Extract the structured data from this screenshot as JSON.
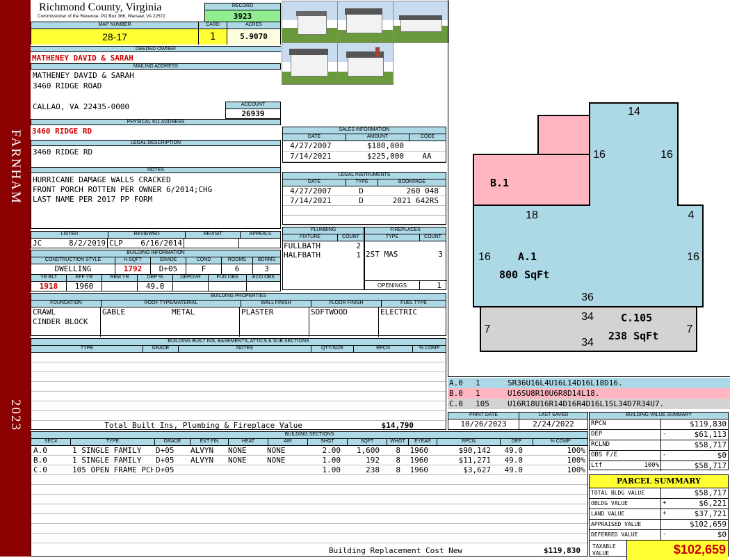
{
  "side": {
    "left_text": "FARNHAM",
    "year": "2023"
  },
  "header": {
    "county": "Richmond County, Virginia",
    "commissioner": "Commissioner of the Revenue, PO Box 366, Warsaw, VA 22572",
    "record_label": "RECORD",
    "record": "3923",
    "map_label": "MAP NUMBER",
    "map_number": "28-17",
    "card_label": "CARD",
    "card": "1",
    "acres_label": "ACRES",
    "acres": "5.9070"
  },
  "owner": {
    "deeded_label": "DEEDED OWNER",
    "deeded": "MATHENEY DAVID & SARAH",
    "mailing_label": "MAILING ADDRESS",
    "mail1": "MATHENEY DAVID & SARAH",
    "mail2": "3460 RIDGE ROAD",
    "mail3": "CALLAO, VA 22435-0000",
    "account_label": "ACCOUNT",
    "account": "26939",
    "phys_label": "PHYSICAL 911 ADDRESS",
    "phys": "3460 RIDGE RD",
    "legal_label": "LEGAL DESCRIPTION",
    "legal": "3460 RIDGE RD",
    "notes_label": "NOTES",
    "notes1": "HURRICANE DAMAGE WALLS CRACKED",
    "notes2": "FRONT PORCH ROTTEN PER OWNER 6/2014;CHG",
    "notes3": "LAST NAME PER 2017 PP FORM"
  },
  "review": {
    "listed_label": "LISTED",
    "reviewed_label": "REVIEWED",
    "revisit_label": "REVISIT",
    "appeals_label": "APPEALS",
    "listed_by": "JC",
    "listed_date": "8/2/2019",
    "reviewed_by": "CLP",
    "reviewed_date": "6/16/2014"
  },
  "building_info": {
    "title": "BUILDING INFORMATION",
    "h_style": "CONSTRUCTION STYLE",
    "h_sqft": "H SQFT",
    "h_grade": "GRADE",
    "h_cond": "COND",
    "h_rooms": "ROOMS",
    "h_bdrms": "BDRMS",
    "style": "DWELLING",
    "sqft": "1792",
    "grade": "D+05",
    "cond": "F",
    "rooms": "6",
    "bdrms": "3",
    "h_yrblt": "YR BLT",
    "h_effyr": "EFF YR",
    "h_remyr": "REM YR",
    "h_dep": "DEP %",
    "h_depovr": "DEPOVR",
    "h_funobs": "FUN OBS",
    "h_ecoobs": "ECO OBS",
    "yrblt": "1918",
    "effyr": "1960",
    "dep": "49.0"
  },
  "properties": {
    "title": "BUILDING PROPERTIES",
    "h_found": "FOUNDATION",
    "h_roof": "ROOF TYPE/MATERIAL",
    "h_wall": "WALL FINISH",
    "h_floor": "FLOOR FINISH",
    "h_fuel": "FUEL TYPE",
    "found1": "CRAWL",
    "found2": "CINDER BLOCK",
    "roof1": "GABLE",
    "roof2": "METAL",
    "wall": "PLASTER",
    "floor": "SOFTWOOD",
    "fuel": "ELECTRIC"
  },
  "builtins": {
    "title": "BUILDING BUILT INS, BASEMENTS, ATTICS & SUB SECTIONS",
    "h_type": "TYPE",
    "h_grade": "GRADE",
    "h_notes": "NOTES",
    "h_qty": "QTY/SIZE",
    "h_rpcn": "RPCN",
    "h_comp": "% COMP",
    "total_label": "Total Built Ins, Plumbing & Fireplace Value",
    "total": "$14,790"
  },
  "sales": {
    "title": "SALES INFORMATION",
    "h_date": "DATE",
    "h_amount": "AMOUNT",
    "h_code": "CODE",
    "rows": [
      {
        "date": "4/27/2007",
        "amount": "$180,000",
        "code": ""
      },
      {
        "date": "7/14/2021",
        "amount": "$225,000",
        "code": "AA"
      }
    ]
  },
  "legal_instruments": {
    "title": "LEGAL INSTRUMENTS",
    "h_date": "DATE",
    "h_type": "TYPE",
    "h_book": "BOOKPAGE",
    "rows": [
      {
        "date": "4/27/2007",
        "type": "D",
        "book": "260 048"
      },
      {
        "date": "7/14/2021",
        "type": "D",
        "book": "2021 642RS"
      }
    ]
  },
  "plumbing": {
    "title": "PLUMBING",
    "h_fixture": "FIXTURE",
    "h_count": "COUNT",
    "rows": [
      {
        "fixture": "FULLBATH",
        "count": "2"
      },
      {
        "fixture": "HALFBATH",
        "count": "1"
      }
    ]
  },
  "fireplaces": {
    "title": "FIREPLACES",
    "h_type": "TYPE",
    "h_count": "COUNT",
    "type": "2ST MAS",
    "count": "3",
    "openings_label": "OPENINGS",
    "openings": "1"
  },
  "sketch": {
    "a_label": "A.1",
    "a_area": "800 SqFt",
    "b_label": "B.1",
    "c_label": "C.105",
    "c_area": "238 SqFt",
    "dims": {
      "top": "14",
      "left16": "16",
      "right16": "16",
      "mid18": "18",
      "right4": "4",
      "aleft16": "16",
      "aright16": "16",
      "bottom36": "36",
      "c34top": "34",
      "c34bot": "34",
      "cleft7": "7",
      "cright7": "7"
    },
    "colors": {
      "a": "#add8e6",
      "b": "#ffb6c1",
      "c": "#d3d3d3"
    }
  },
  "sections_legend": [
    {
      "sec": "A.0",
      "n": "1",
      "path": "SR36U16L4U16L14D16L18D16."
    },
    {
      "sec": "B.0",
      "n": "1",
      "path": "U16SU8R10U6R8D14L18."
    },
    {
      "sec": "C.0",
      "n": "105",
      "path": "U16R18U16R14D16R4D16L1SL34D7R34U7."
    }
  ],
  "print": {
    "print_label": "PRINT DATE",
    "saved_label": "LAST SAVED",
    "print_date": "10/26/2023",
    "last_saved": "2/24/2022"
  },
  "value_summary": {
    "title": "BUILDING VALUE SUMMARY",
    "rpcn_label": "RPCN",
    "rpcn": "$119,830",
    "dep_label": "DEP",
    "dep_sign": "-",
    "dep": "$61,113",
    "rclnd_label": "RCLND",
    "rclnd": "$58,717",
    "obs_label": "OBS F/E",
    "obs_sign": "-",
    "obs": "$0",
    "ltf_label": "Ltf",
    "ltf_pct": "100%",
    "ltf": "$58,717"
  },
  "parcel": {
    "title": "PARCEL SUMMARY",
    "total_bldg_label": "TOTAL BLDG VALUE",
    "total_bldg": "$58,717",
    "obldg_label": "OBLDG VALUE",
    "obldg_sign": "+",
    "obldg": "$6,221",
    "land_label": "LAND VALUE",
    "land_sign": "+",
    "land": "$37,721",
    "appraised_label": "APPRAISED VALUE",
    "appraised": "$102,659",
    "deferred_label": "DEFERRED VALUE",
    "deferred_sign": "-",
    "deferred": "$0",
    "taxable_label1": "TAXABLE",
    "taxable_label2": "VALUE",
    "taxable": "$102,659"
  },
  "building_sections": {
    "title": "BUILDING SECTIONS",
    "headers": [
      "SEC#",
      "TYPE",
      "GRADE",
      "EXT FIN",
      "HEAT",
      "AIR",
      "SHGT",
      "SQFT",
      "WHGT",
      "EYEAR",
      "RPCN",
      "DEP",
      "% COMP"
    ],
    "rows": [
      {
        "sec": "A.0",
        "type": "1 SINGLE FAMILY",
        "grade": "D+05",
        "ext": "ALVYN",
        "heat": "NONE",
        "air": "NONE",
        "shgt": "2.00",
        "sqft": "1,600",
        "whgt": "8",
        "eyear": "1960",
        "rpcn": "$90,142",
        "dep": "49.0",
        "comp": "100%"
      },
      {
        "sec": "B.0",
        "type": "1 SINGLE FAMILY",
        "grade": "D+05",
        "ext": "ALVYN",
        "heat": "NONE",
        "air": "NONE",
        "shgt": "1.00",
        "sqft": "192",
        "whgt": "8",
        "eyear": "1960",
        "rpcn": "$11,271",
        "dep": "49.0",
        "comp": "100%"
      },
      {
        "sec": "C.0",
        "type": "105 OPEN FRAME PCH",
        "grade": "D+05",
        "ext": "",
        "heat": "",
        "air": "",
        "shgt": "1.00",
        "sqft": "238",
        "whgt": "8",
        "eyear": "1960",
        "rpcn": "$3,627",
        "dep": "49.0",
        "comp": "100%"
      }
    ],
    "replacement_label": "Building Replacement Cost New",
    "replacement": "$119,830"
  }
}
